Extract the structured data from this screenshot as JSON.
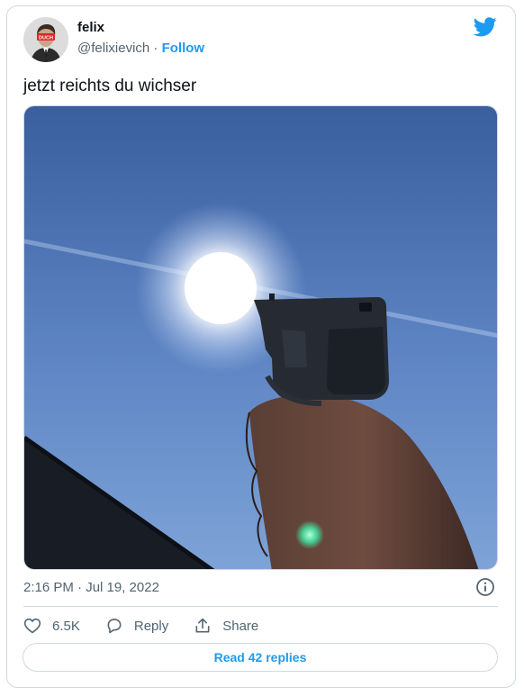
{
  "author": {
    "name": "felix",
    "handle": "@felixievich",
    "separator": " · ",
    "follow_label": "Follow",
    "avatar_badge": "DUCH"
  },
  "tweet": {
    "text": "jetzt reichts du wichser",
    "timestamp": "2:16 PM · Jul 19, 2022"
  },
  "actions": {
    "likes": "6.5K",
    "reply_label": "Reply",
    "share_label": "Share"
  },
  "read_replies_label": "Read 42 replies",
  "colors": {
    "accent": "#1d9bf0",
    "muted": "#536471",
    "border": "#cfd9de"
  },
  "icons": [
    "twitter-bird-icon",
    "info-icon",
    "heart-icon",
    "reply-icon",
    "share-icon"
  ]
}
